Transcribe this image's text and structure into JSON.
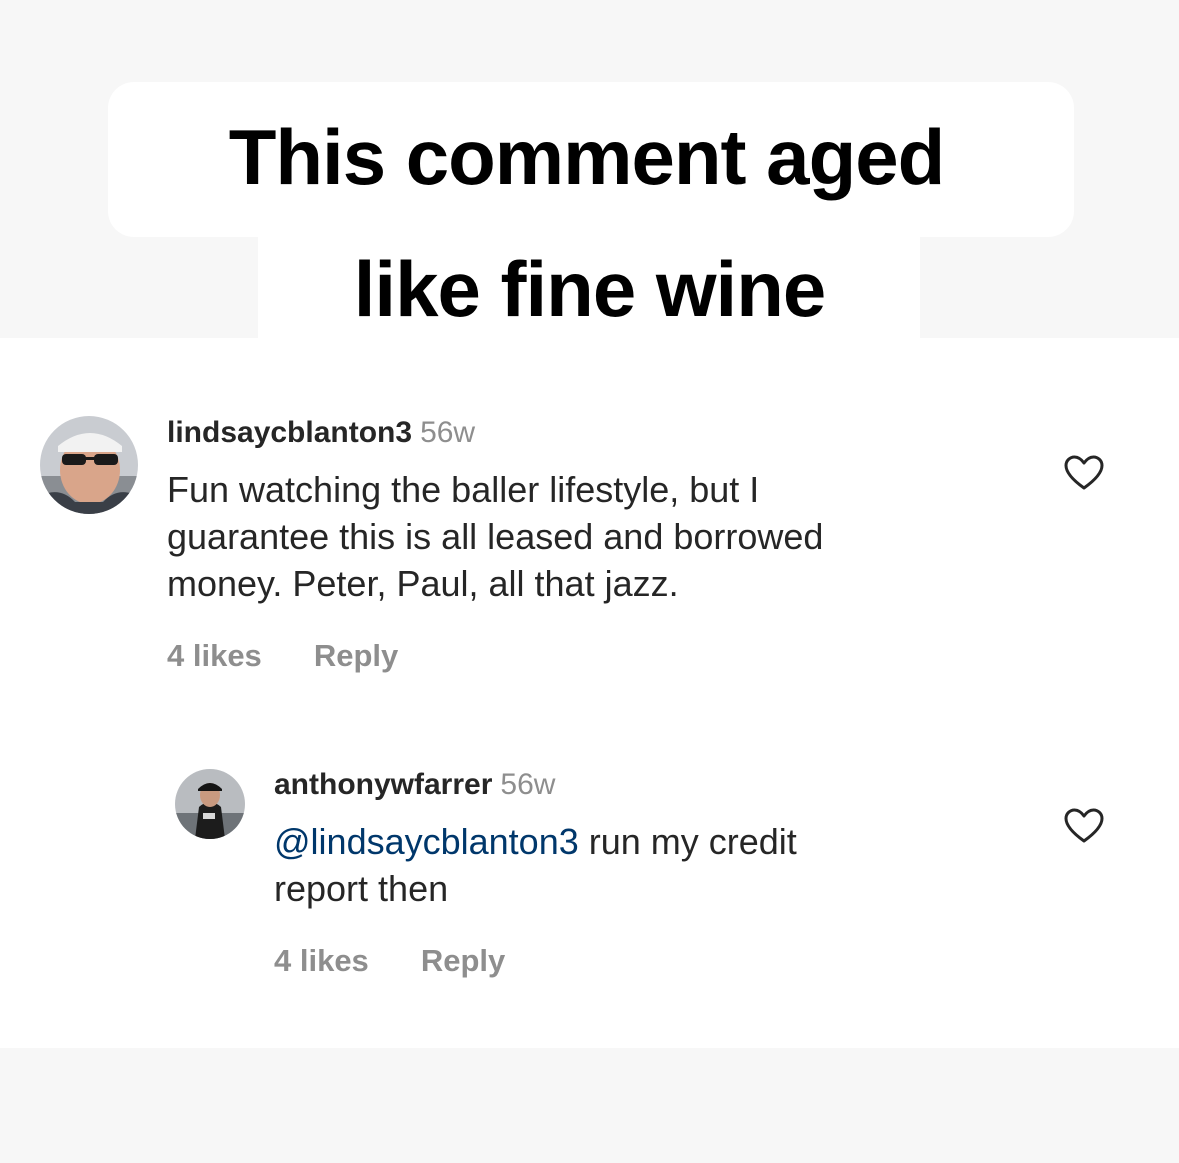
{
  "caption": {
    "line1": "This comment aged",
    "line2": "like fine wine"
  },
  "comments": [
    {
      "username": "lindsaycblanton3",
      "time": "56w",
      "text_lines": [
        "Fun watching the baller lifestyle, but I",
        "guarantee this is all leased and borrowed",
        "money. Peter, Paul, all that jazz."
      ],
      "likes": "4 likes",
      "reply_label": "Reply",
      "like_icon": "heart-outline-icon"
    },
    {
      "username": "anthonywfarrer",
      "time": "56w",
      "mention": "@lindsaycblanton3",
      "text_rest_line1": " run my credit",
      "text_line2": "report then",
      "likes": "4 likes",
      "reply_label": "Reply",
      "like_icon": "heart-outline-icon"
    }
  ],
  "colors": {
    "text": "#262626",
    "secondary": "#8e8e8e",
    "mention": "#00376b",
    "background": "#f7f7f7"
  }
}
